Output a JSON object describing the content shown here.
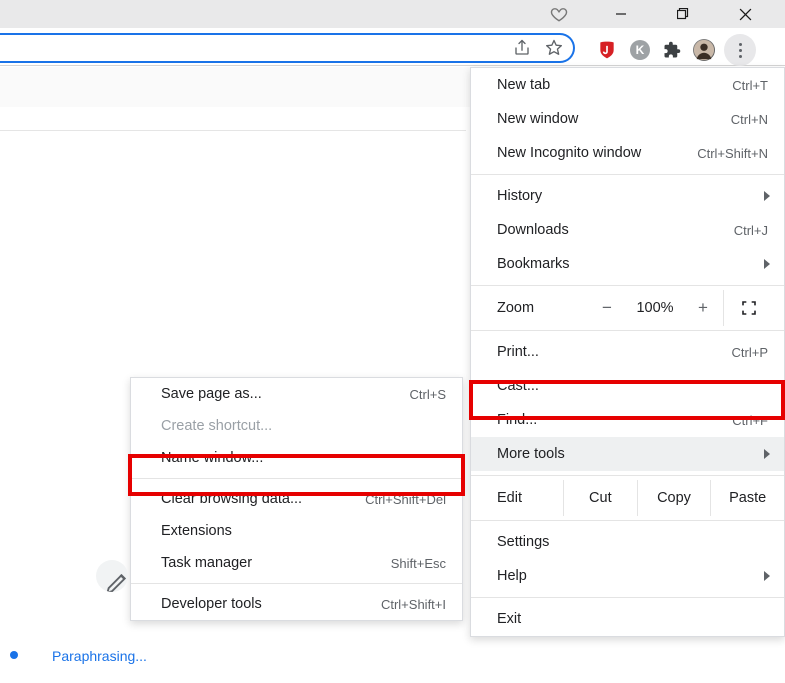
{
  "window": {
    "heart_icon": "heart"
  },
  "menu": {
    "new_tab": "New tab",
    "new_tab_sc": "Ctrl+T",
    "new_window": "New window",
    "new_window_sc": "Ctrl+N",
    "incognito": "New Incognito window",
    "incognito_sc": "Ctrl+Shift+N",
    "history": "History",
    "downloads": "Downloads",
    "downloads_sc": "Ctrl+J",
    "bookmarks": "Bookmarks",
    "zoom": "Zoom",
    "zoom_minus": "−",
    "zoom_val": "100%",
    "zoom_plus": "+",
    "print": "Print...",
    "print_sc": "Ctrl+P",
    "cast": "Cast...",
    "find": "Find...",
    "find_sc": "Ctrl+F",
    "more_tools": "More tools",
    "edit": "Edit",
    "cut": "Cut",
    "copy": "Copy",
    "paste": "Paste",
    "settings": "Settings",
    "help": "Help",
    "exit": "Exit"
  },
  "submenu": {
    "save_page": "Save page as...",
    "save_page_sc": "Ctrl+S",
    "create_shortcut": "Create shortcut...",
    "name_window": "Name window...",
    "clear_data": "Clear browsing data...",
    "clear_data_sc": "Ctrl+Shift+Del",
    "extensions": "Extensions",
    "task_manager": "Task manager",
    "task_manager_sc": "Shift+Esc",
    "devtools": "Developer tools",
    "devtools_sc": "Ctrl+Shift+I"
  },
  "toolbar": {
    "ext_k": "K"
  },
  "footer": {
    "paraphrasing": "Paraphrasing..."
  }
}
